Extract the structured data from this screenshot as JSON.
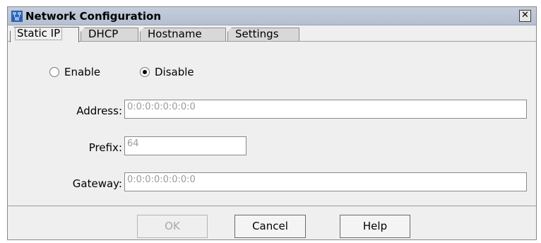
{
  "window": {
    "title": "Network Configuration",
    "close_glyph": "✕",
    "title_icon": "network-icon"
  },
  "tabs": [
    {
      "label": "Static IP",
      "active": true
    },
    {
      "label": "DHCP",
      "active": false
    },
    {
      "label": "Hostname",
      "active": false
    },
    {
      "label": "Settings",
      "active": false
    }
  ],
  "mode": {
    "enable_label": "Enable",
    "disable_label": "Disable",
    "selected": "Disable"
  },
  "fields": {
    "address": {
      "label": "Address:",
      "value": "0:0:0:0:0:0:0:0"
    },
    "prefix": {
      "label": "Prefix:",
      "value": "64"
    },
    "gateway": {
      "label": "Gateway:",
      "value": "0:0:0:0:0:0:0:0"
    }
  },
  "buttons": {
    "ok": "OK",
    "cancel": "Cancel",
    "help": "Help"
  },
  "colors": {
    "titlebar": "#b5bfcf",
    "window_bg": "#efefef",
    "disabled_text": "#9a9a9a"
  }
}
